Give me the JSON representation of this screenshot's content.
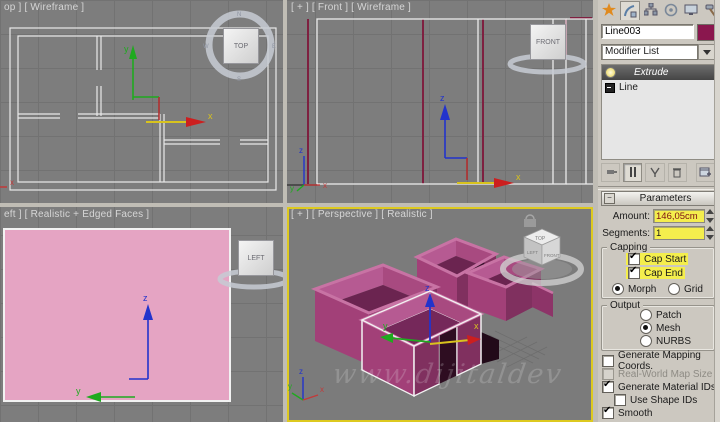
{
  "viewports": {
    "top": {
      "label": "op ] [ Wireframe ]"
    },
    "front": {
      "label": "[ + ] [ Front ] [ Wireframe ]"
    },
    "left": {
      "label": "eft ] [ Realistic + Edged Faces ]"
    },
    "persp": {
      "label": "[ + ] [ Perspective ] [ Realistic ]",
      "watermark": "www.dijitaldev"
    }
  },
  "viewcube": {
    "top": "TOP",
    "front": "FRONT",
    "left": "LEFT",
    "persp_top": "TOP",
    "persp_left": "LEFT",
    "persp_front": "FRONT",
    "compass": {
      "n": "N",
      "e": "E",
      "s": "S",
      "w": "W"
    }
  },
  "axes": {
    "x": "x",
    "y": "y",
    "z": "z"
  },
  "panel": {
    "object_name": "Line003",
    "modifier_list": "Modifier List",
    "stack": {
      "modifier": "Extrude",
      "base": "Line"
    },
    "rollout_title": "Parameters",
    "amount_label": "Amount:",
    "amount_value": "146,05cm",
    "segments_label": "Segments:",
    "segments_value": "1",
    "capping_legend": "Capping",
    "cap_start": "Cap Start",
    "cap_end": "Cap End",
    "morph": "Morph",
    "grid": "Grid",
    "output_legend": "Output",
    "patch": "Patch",
    "mesh": "Mesh",
    "nurbs": "NURBS",
    "gen_mapping": "Generate Mapping Coords.",
    "real_world": "Real-World Map Size",
    "gen_material": "Generate Material IDs",
    "use_shape": "Use Shape IDs",
    "smooth": "Smooth"
  },
  "colors": {
    "highlight_yellow": "#f4ee4d",
    "object_color": "#8a174e",
    "wall_pink": "#a24078",
    "active_border": "#ddc91f",
    "viewport_bg": "#7d7d7d",
    "amount_text": "#7c1014"
  }
}
